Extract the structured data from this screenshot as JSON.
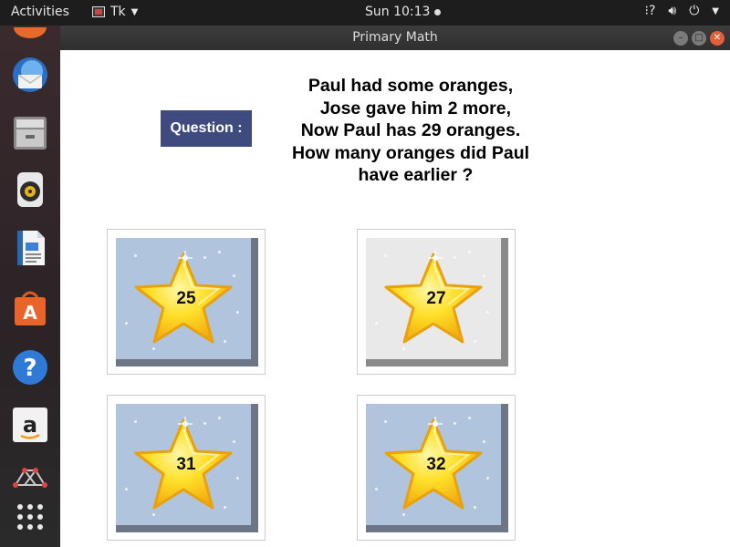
{
  "topbar": {
    "activities": "Activities",
    "app_name": "Tk",
    "clock": "Sun 10:13"
  },
  "dock": {
    "items": [
      "thunderbird-icon",
      "files-icon",
      "rhythmbox-icon",
      "libreoffice-writer-icon",
      "software-center-icon",
      "help-icon",
      "amazon-icon",
      "network-icon",
      "show-apps-icon"
    ]
  },
  "window": {
    "title": "Primary Math"
  },
  "question": {
    "label": "Question :",
    "text": "Paul had some oranges,\n  Jose gave him 2 more,\nNow Paul has 29 oranges.\nHow many oranges did Paul\n  have earlier ?"
  },
  "answers": [
    {
      "value": "25",
      "selected": false
    },
    {
      "value": "27",
      "selected": true
    },
    {
      "value": "31",
      "selected": false
    },
    {
      "value": "32",
      "selected": false
    }
  ],
  "colors": {
    "question_label_bg": "#3f4b7e",
    "answer_face": "#b1c4dd",
    "answer_face_selected": "#e9e9e9",
    "star_yellow": "#ffd21a"
  }
}
